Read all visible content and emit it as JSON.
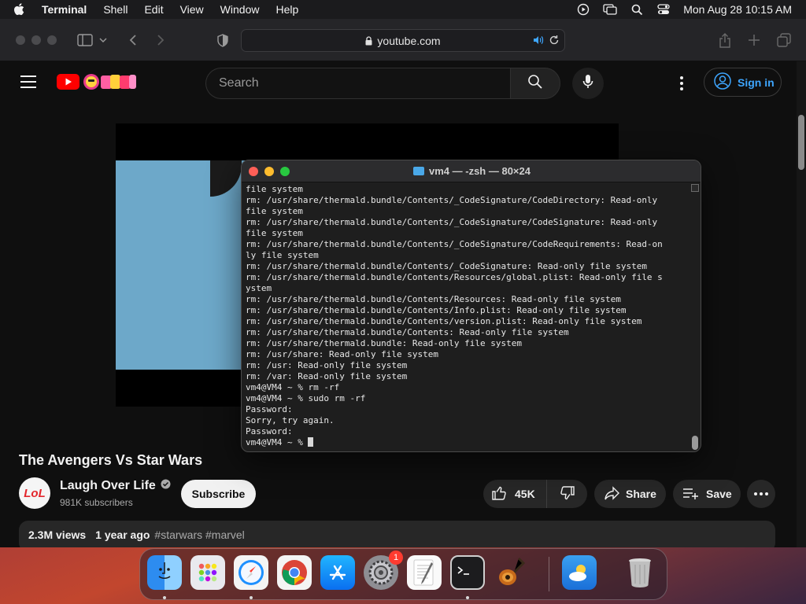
{
  "menubar": {
    "app_name": "Terminal",
    "items": [
      "Shell",
      "Edit",
      "View",
      "Window",
      "Help"
    ],
    "clock": "Mon Aug 28  10:15 AM"
  },
  "browser": {
    "url": "youtube.com"
  },
  "youtube": {
    "search_placeholder": "Search",
    "signin_label": "Sign in",
    "video_title": "The Avengers Vs Star Wars",
    "channel_name": "Laugh Over Life",
    "channel_avatar_text": "LoL",
    "subscribers": "981K subscribers",
    "subscribe_label": "Subscribe",
    "likes": "45K",
    "share_label": "Share",
    "save_label": "Save",
    "views": "2.3M views",
    "age": "1 year ago",
    "tags": "#starwars #marvel"
  },
  "terminal": {
    "title": "vm4 — -zsh — 80×24",
    "lines": [
      "file system",
      "rm: /usr/share/thermald.bundle/Contents/_CodeSignature/CodeDirectory: Read-only",
      "file system",
      "rm: /usr/share/thermald.bundle/Contents/_CodeSignature/CodeSignature: Read-only",
      "file system",
      "rm: /usr/share/thermald.bundle/Contents/_CodeSignature/CodeRequirements: Read-on",
      "ly file system",
      "rm: /usr/share/thermald.bundle/Contents/_CodeSignature: Read-only file system",
      "rm: /usr/share/thermald.bundle/Contents/Resources/global.plist: Read-only file s",
      "ystem",
      "rm: /usr/share/thermald.bundle/Contents/Resources: Read-only file system",
      "rm: /usr/share/thermald.bundle/Contents/Info.plist: Read-only file system",
      "rm: /usr/share/thermald.bundle/Contents/version.plist: Read-only file system",
      "rm: /usr/share/thermald.bundle/Contents: Read-only file system",
      "rm: /usr/share/thermald.bundle: Read-only file system",
      "rm: /usr/share: Read-only file system",
      "rm: /usr: Read-only file system",
      "rm: /var: Read-only file system",
      "vm4@VM4 ~ % rm -rf",
      "vm4@VM4 ~ % sudo rm -rf",
      "Password:",
      "Sorry, try again.",
      "Password:",
      "vm4@VM4 ~ % "
    ]
  },
  "dock": {
    "apps": [
      "finder",
      "launchpad",
      "safari",
      "chrome",
      "app-store",
      "system-settings",
      "textedit",
      "terminal",
      "garageband",
      "weather",
      "trash"
    ],
    "settings_badge": "1"
  }
}
